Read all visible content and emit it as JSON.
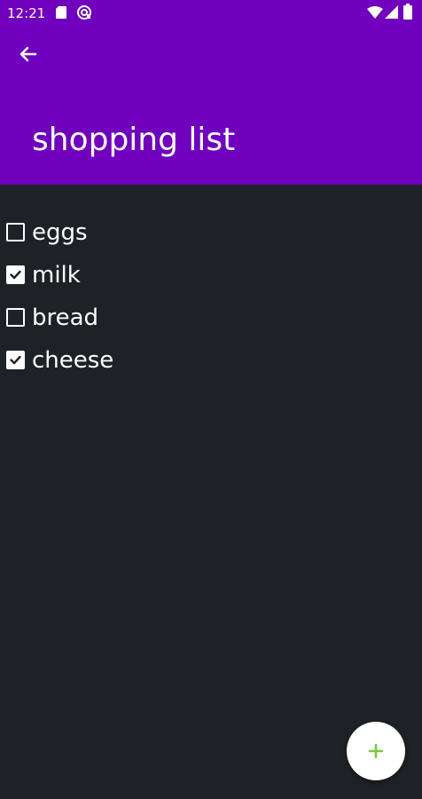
{
  "status_bar": {
    "time": "12:21",
    "icons": [
      "sd-card-icon",
      "sync-icon",
      "wifi-icon",
      "signal-icon",
      "battery-icon"
    ]
  },
  "app_bar": {
    "title": "shopping list",
    "back_icon": "arrow-back-icon",
    "background_color": "#7000bd"
  },
  "list": {
    "items": [
      {
        "label": "eggs",
        "checked": false
      },
      {
        "label": "milk",
        "checked": true
      },
      {
        "label": "bread",
        "checked": false
      },
      {
        "label": "cheese",
        "checked": true
      }
    ]
  },
  "fab": {
    "icon": "plus-icon",
    "icon_color": "#7ac943",
    "background_color": "#ffffff"
  },
  "colors": {
    "background": "#1e2227",
    "text": "#ffffff"
  }
}
